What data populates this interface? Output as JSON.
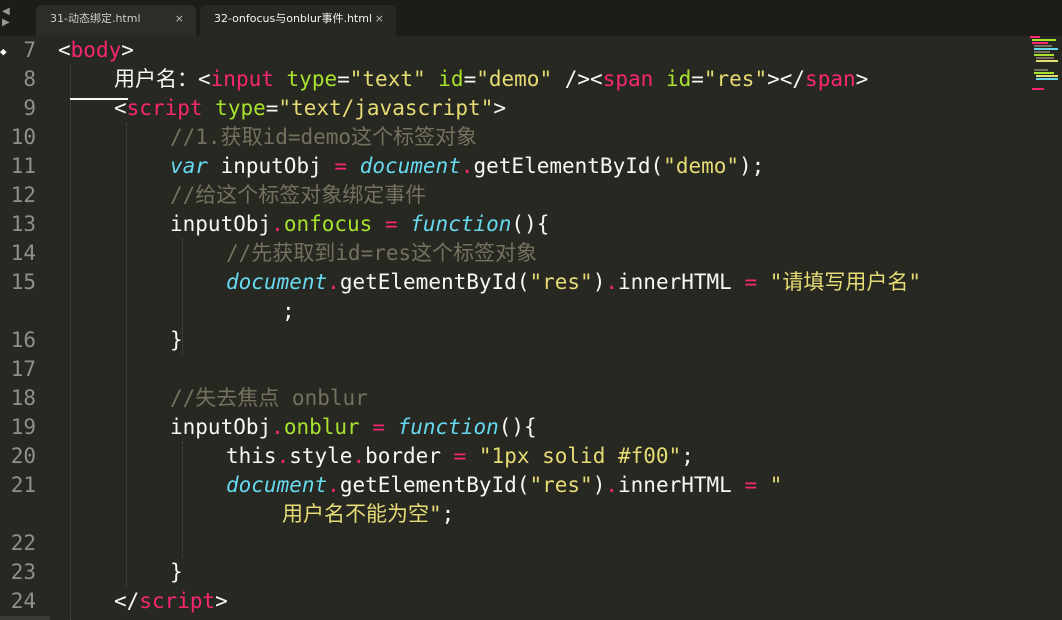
{
  "tabs": [
    {
      "label": "31-动态绑定.html",
      "close": "×"
    },
    {
      "label": "32-onfocus与onblur事件.html",
      "close": "×"
    }
  ],
  "nav_arrows": "◀ ▶",
  "colors": {
    "background": "#272822",
    "tag": "#f92672",
    "attribute": "#a6e22e",
    "string": "#e6db74",
    "comment": "#75715e",
    "keyword": "#66d9ef",
    "text": "#f8f8f2"
  },
  "gutter": {
    "line_numbers": [
      "7",
      "8",
      "9",
      "10",
      "11",
      "12",
      "13",
      "14",
      "15",
      "",
      "16",
      "17",
      "18",
      "19",
      "20",
      "21",
      "",
      "22",
      "23",
      "24"
    ]
  },
  "code": {
    "l7": {
      "open": "<",
      "tag": "body",
      "close": ">"
    },
    "l8": {
      "label": "用户名：",
      "lt": "<",
      "tag1": "input",
      "attr1": "type",
      "eq1": "=",
      "val1": "\"text\"",
      "attr2": "id",
      "eq2": "=",
      "val2": "\"demo\"",
      "selfclose": " />",
      "lt2": "<",
      "tag2": "span",
      "attr3": "id",
      "eq3": "=",
      "val3": "\"res\"",
      "gt": ">",
      "endlt": "</",
      "tag3": "span",
      "endgt": ">"
    },
    "l9": {
      "lt": "<",
      "tag": "script",
      "attr": "type",
      "eq": "=",
      "val": "\"text/javascript\"",
      "gt": ">"
    },
    "l10": {
      "comment": "//1.获取id=demo这个标签对象"
    },
    "l11": {
      "kw": "var",
      "name": " inputObj ",
      "eq": "=",
      "obj": "document",
      "dot": ".",
      "fn": "getElementById",
      "paren1": "(",
      "str": "\"demo\"",
      "paren2": ");"
    },
    "l12": {
      "comment": "//给这个标签对象绑定事件"
    },
    "l13": {
      "name": "inputObj",
      "dot": ".",
      "prop": "onfocus",
      "eq": " = ",
      "kw": "function",
      "rest": "(){"
    },
    "l14": {
      "comment": "//先获取到id=res这个标签对象"
    },
    "l15": {
      "obj": "document",
      "dot": ".",
      "fn": "getElementById",
      "paren1": "(",
      "str": "\"res\"",
      "paren2": ")",
      "dot2": ".",
      "prop": "innerHTML",
      "eq": " = ",
      "str2": "\"请填写用户名\""
    },
    "l15b": {
      "semi": ";"
    },
    "l16": {
      "brace": "}"
    },
    "l18": {
      "comment": "//失去焦点 onblur"
    },
    "l19": {
      "name": "inputObj",
      "dot": ".",
      "prop": "onblur",
      "eq": " = ",
      "kw": "function",
      "rest": "(){"
    },
    "l20": {
      "this": "this",
      "dot": ".",
      "prop": "style",
      "dot2": ".",
      "prop2": "border",
      "eq": " = ",
      "str": "\"1px solid #f00\"",
      "semi": ";"
    },
    "l21": {
      "obj": "document",
      "dot": ".",
      "fn": "getElementById",
      "paren1": "(",
      "str": "\"res\"",
      "paren2": ")",
      "dot2": ".",
      "prop": "innerHTML",
      "eq": " = ",
      "str2": "\""
    },
    "l21b": {
      "str": "用户名不能为空\"",
      "semi": ";"
    },
    "l23": {
      "brace": "}"
    },
    "l24": {
      "lt": "</",
      "tag": "script",
      "gt": ">"
    }
  }
}
